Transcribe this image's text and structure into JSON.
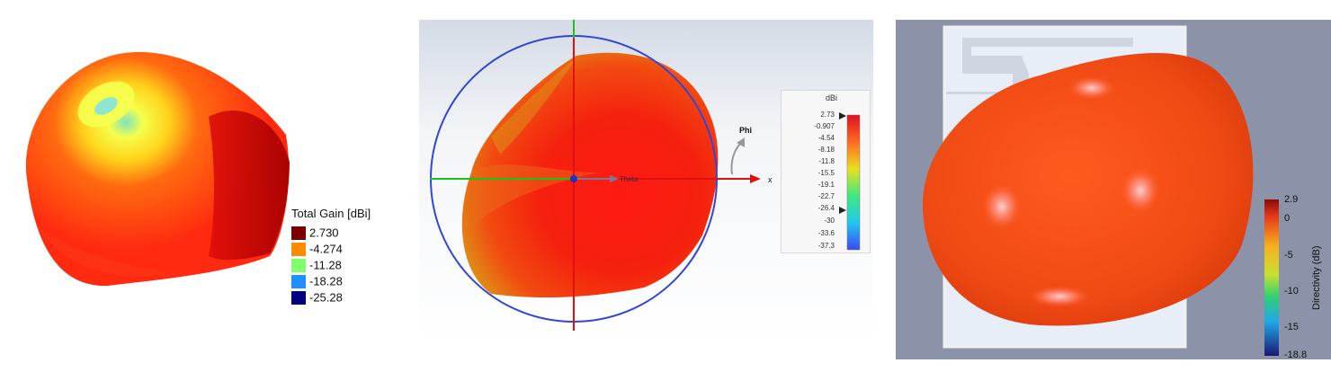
{
  "panel1": {
    "legend_title": "Total Gain [dBi]",
    "legend": [
      {
        "label": "2.730",
        "color": "#7a0000"
      },
      {
        "label": "-4.274",
        "color": "#ff8c00"
      },
      {
        "label": "-11.28",
        "color": "#7fff6a"
      },
      {
        "label": "-18.28",
        "color": "#1e90ff"
      },
      {
        "label": "-25.28",
        "color": "#000080"
      }
    ]
  },
  "panel2": {
    "theta_label": "Theta",
    "phi_label": "Phi",
    "x_label": "x",
    "colorbar_unit": "dBi",
    "colorbar_ticks": [
      "2.73",
      "-0.907",
      "-4.54",
      "-8.18",
      "-11.8",
      "-15.5",
      "-19.1",
      "-22.7",
      "-26.4",
      "-30",
      "-33.6",
      "-37.3"
    ]
  },
  "panel3": {
    "colorbar_label": "Directivity (dB)",
    "colorbar_ticks": [
      "2.9",
      "0",
      "-5",
      "-10",
      "-15",
      "-18.8"
    ]
  }
}
